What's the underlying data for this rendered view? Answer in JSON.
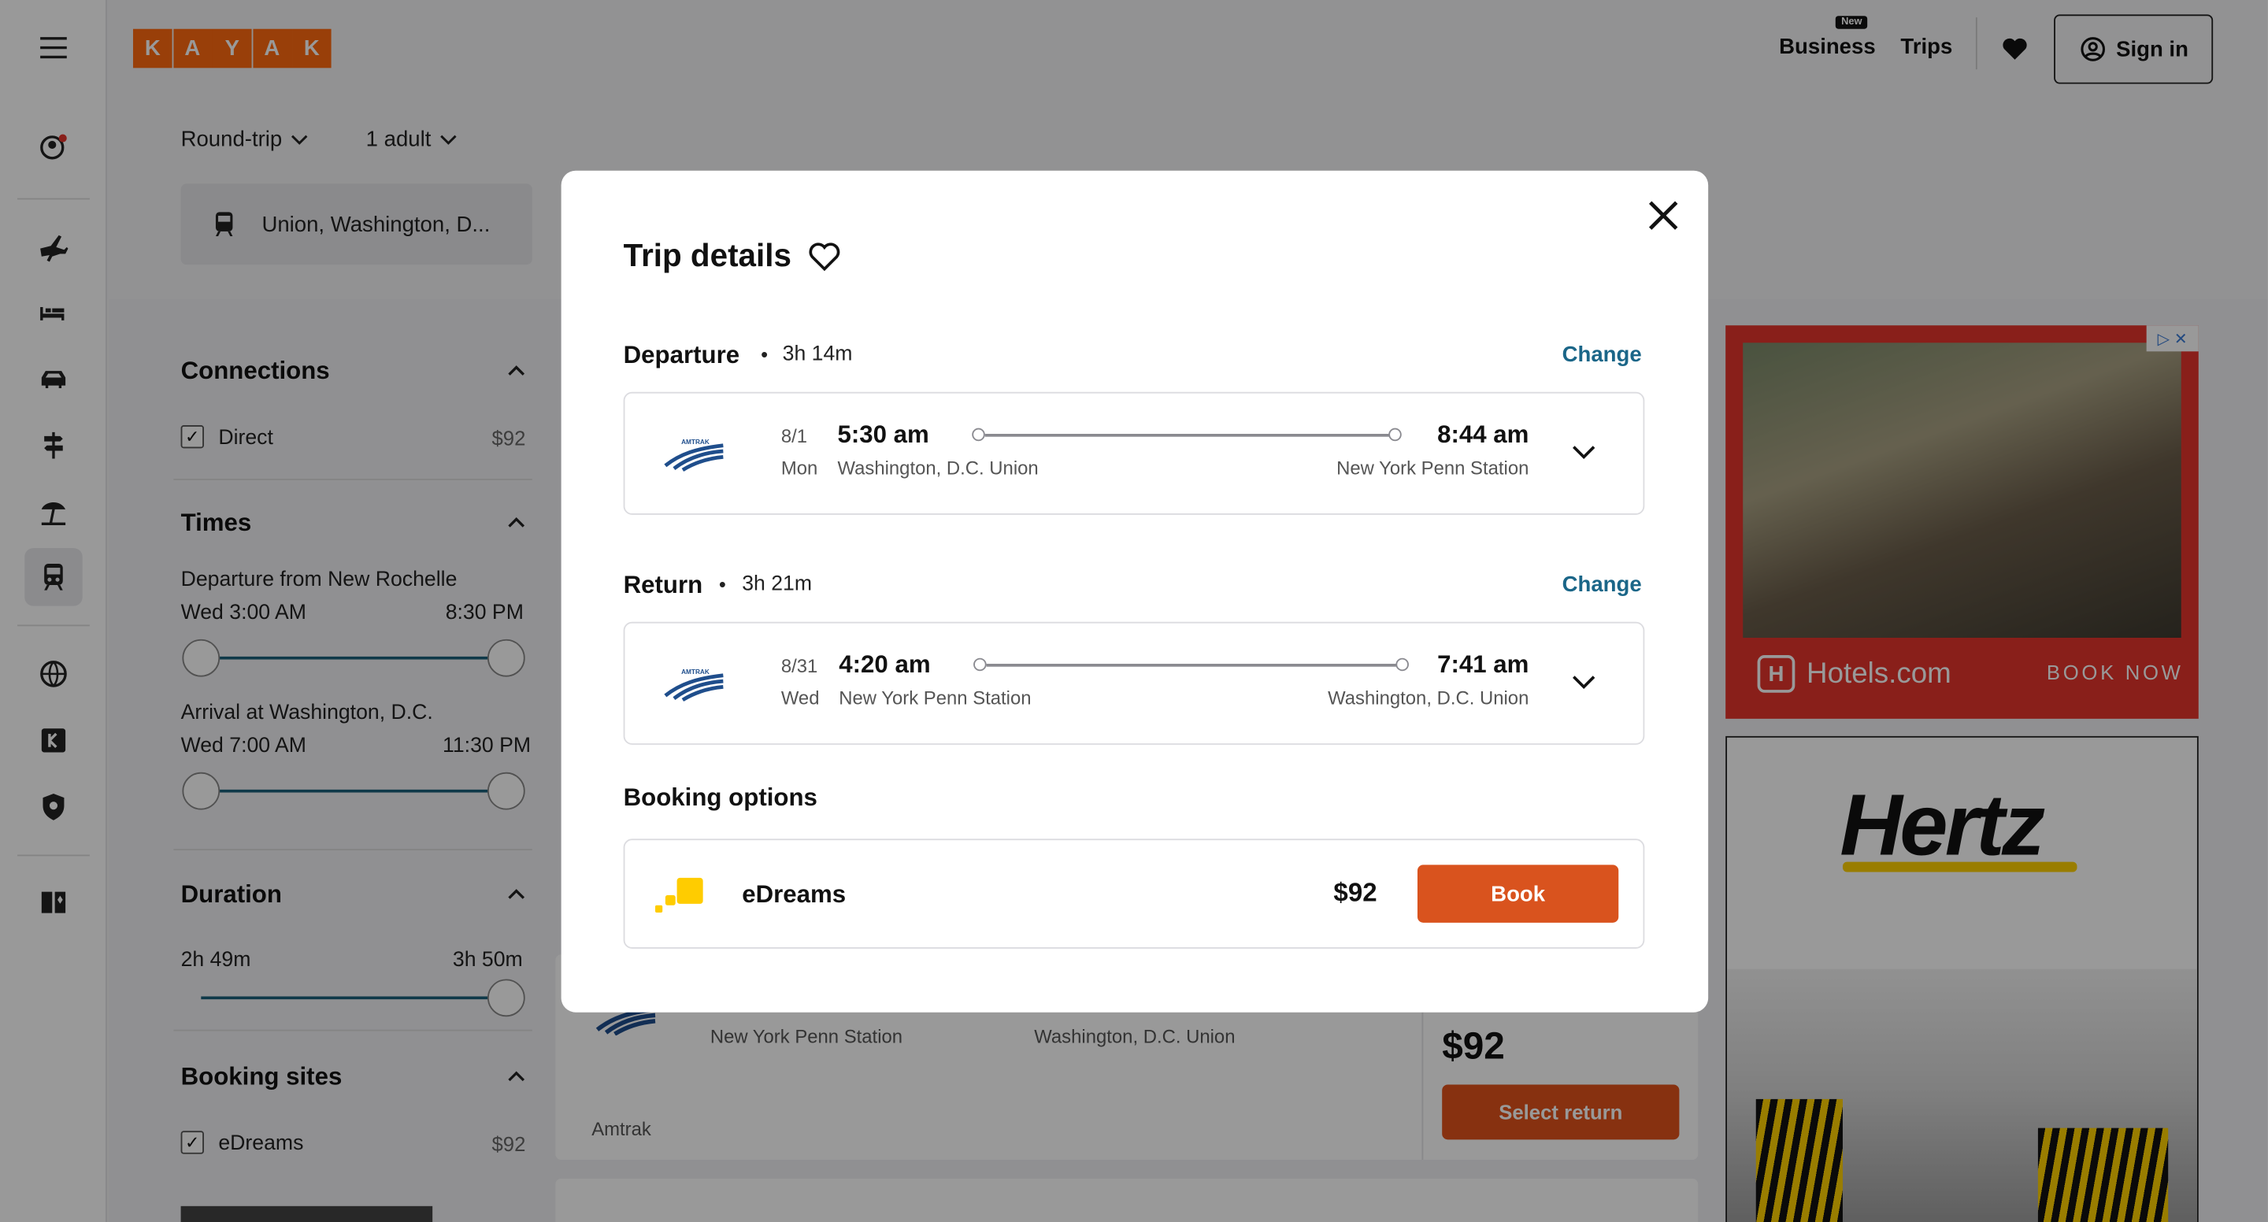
{
  "header": {
    "logo_letters": [
      "K",
      "A",
      "Y",
      "A",
      "K"
    ],
    "business_label": "Business",
    "new_badge": "New",
    "trips_label": "Trips",
    "signin_label": "Sign in"
  },
  "search": {
    "trip_type": "Round-trip",
    "travelers": "1 adult",
    "origin": "Union, Washington, D..."
  },
  "filters": {
    "connections": {
      "title": "Connections",
      "option": "Direct",
      "price": "$92"
    },
    "times": {
      "title": "Times",
      "departure_label": "Departure from New Rochelle",
      "departure_min": "Wed 3:00 AM",
      "departure_max": "8:30 PM",
      "arrival_label": "Arrival at Washington, D.C.",
      "arrival_min": "Wed 7:00 AM",
      "arrival_max": "11:30 PM"
    },
    "duration": {
      "title": "Duration",
      "min": "2h 49m",
      "max": "3h 50m"
    },
    "booking_sites": {
      "title": "Booking sites",
      "option": "eDreams",
      "price": "$92"
    }
  },
  "result_behind": {
    "from_station": "New York Penn Station",
    "to_station": "Washington, D.C. Union",
    "carrier": "Amtrak",
    "price": "$92",
    "select_label": "Select return"
  },
  "ads": {
    "hotels_brand": "Hotels.com",
    "hotels_cta": "BOOK NOW",
    "hertz_brand": "Hertz"
  },
  "modal": {
    "title": "Trip details",
    "departure": {
      "label": "Departure",
      "duration": "3h 14m",
      "change_label": "Change",
      "date": "8/1",
      "dow": "Mon",
      "depart_time": "5:30 am",
      "depart_station": "Washington, D.C. Union",
      "arrive_time": "8:44 am",
      "arrive_station": "New York Penn Station",
      "carrier_logo_text": "AMTRAK"
    },
    "return": {
      "label": "Return",
      "duration": "3h 21m",
      "change_label": "Change",
      "date": "8/31",
      "dow": "Wed",
      "depart_time": "4:20 am",
      "depart_station": "New York Penn Station",
      "arrive_time": "7:41 am",
      "arrive_station": "Washington, D.C. Union",
      "carrier_logo_text": "AMTRAK"
    },
    "booking_options": {
      "title": "Booking options",
      "provider": "eDreams",
      "price": "$92",
      "book_label": "Book"
    }
  },
  "colors": {
    "brand_orange": "#ff690f",
    "book_button": "#d9531e",
    "link_blue": "#1b6688"
  }
}
